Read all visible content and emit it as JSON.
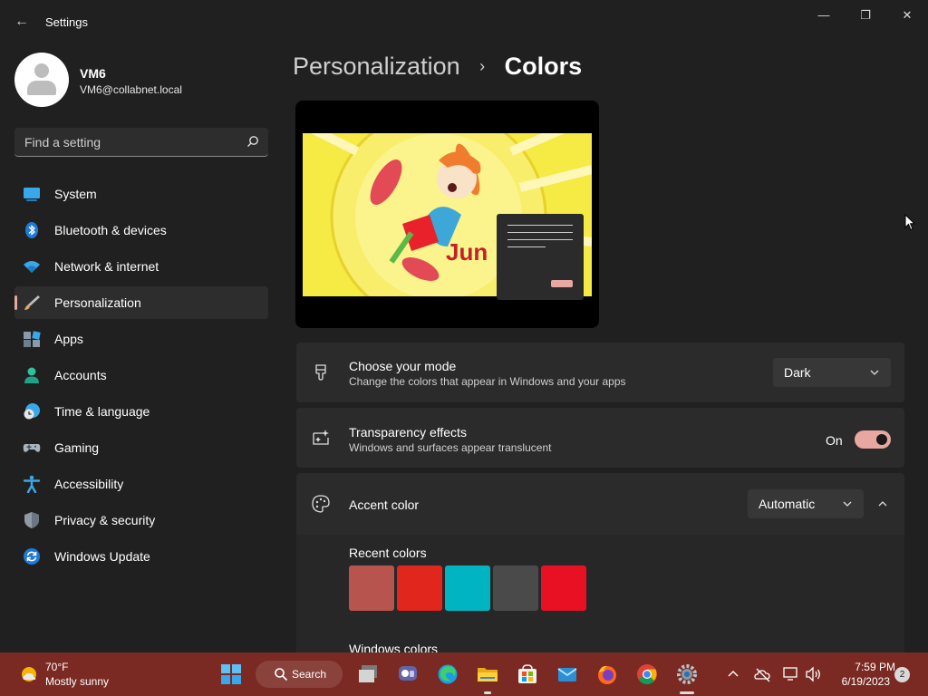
{
  "window": {
    "title": "Settings",
    "back_glyph": "←",
    "minimize_glyph": "—",
    "maximize_glyph": "❐",
    "close_glyph": "✕"
  },
  "profile": {
    "name": "VM6",
    "email": "VM6@collabnet.local"
  },
  "search": {
    "placeholder": "Find a setting"
  },
  "sidebar": {
    "items": [
      {
        "label": "System",
        "icon": "system-icon"
      },
      {
        "label": "Bluetooth & devices",
        "icon": "bluetooth-icon"
      },
      {
        "label": "Network & internet",
        "icon": "wifi-icon"
      },
      {
        "label": "Personalization",
        "icon": "brush-icon",
        "active": true
      },
      {
        "label": "Apps",
        "icon": "apps-icon"
      },
      {
        "label": "Accounts",
        "icon": "person-icon"
      },
      {
        "label": "Time & language",
        "icon": "globe-clock-icon"
      },
      {
        "label": "Gaming",
        "icon": "gamepad-icon"
      },
      {
        "label": "Accessibility",
        "icon": "accessibility-icon"
      },
      {
        "label": "Privacy & security",
        "icon": "shield-icon"
      },
      {
        "label": "Windows Update",
        "icon": "update-icon"
      }
    ]
  },
  "breadcrumb": {
    "parent": "Personalization",
    "separator": "›",
    "current": "Colors"
  },
  "mode": {
    "title": "Choose your mode",
    "description": "Change the colors that appear in Windows and your apps",
    "value": "Dark"
  },
  "transparency": {
    "title": "Transparency effects",
    "description": "Windows and surfaces appear translucent",
    "state_label": "On"
  },
  "accent": {
    "title": "Accent color",
    "value": "Automatic",
    "recent_heading": "Recent colors",
    "recent_colors": [
      "#b8544e",
      "#e0261d",
      "#00b4c2",
      "#4a4a4a",
      "#e81123"
    ],
    "windows_heading": "Windows colors"
  },
  "colors": {
    "accent": "#e8a7a0",
    "taskbar": "#7a2a22"
  },
  "taskbar": {
    "weather_temp": "70°F",
    "weather_desc": "Mostly sunny",
    "search_label": "Search",
    "time": "7:59 PM",
    "date": "6/19/2023",
    "notification_count": "2"
  }
}
